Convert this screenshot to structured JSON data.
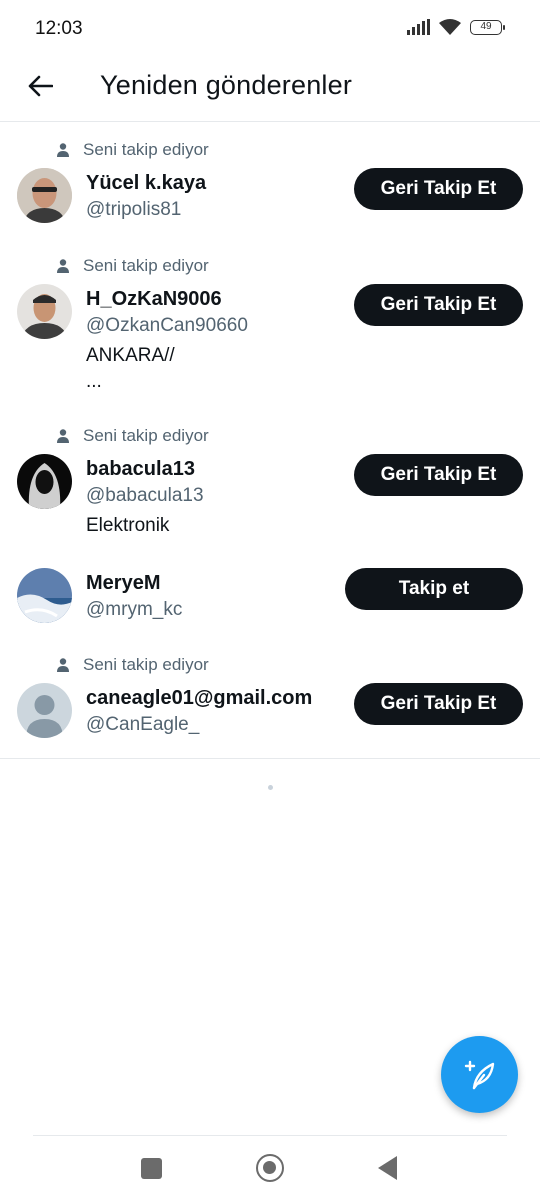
{
  "status_bar": {
    "time": "12:03",
    "battery": "49",
    "icons": [
      "signal-icon",
      "wifi-icon",
      "battery-icon"
    ]
  },
  "header": {
    "title": "Yeniden gönderenler",
    "back_icon": "arrow-left-icon"
  },
  "users": [
    {
      "follows_you": "Seni takip ediyor",
      "name": "Yücel k.kaya",
      "handle": "@tripolis81",
      "bio": [],
      "button": "Geri Takip Et"
    },
    {
      "follows_you": "Seni takip ediyor",
      "name": "H_OzKaN9006",
      "handle": "@OzkanCan90660",
      "bio": [
        "ANKARA//",
        "..."
      ],
      "button": "Geri Takip Et"
    },
    {
      "follows_you": "Seni takip ediyor",
      "name": "babacula13",
      "handle": "@babacula13",
      "bio": [
        "Elektronik"
      ],
      "button": "Geri Takip Et"
    },
    {
      "follows_you": "",
      "name": "MeryeM",
      "handle": "@mrym_kc",
      "bio": [],
      "button": "Takip et"
    },
    {
      "follows_you": "Seni takip ediyor",
      "name": "caneagle01@gmail.com",
      "handle": "@CanEagle_",
      "bio": [],
      "button": "Geri Takip Et"
    }
  ],
  "fab": {
    "icon": "compose-feather-icon"
  },
  "nav_bar": {
    "icons": [
      "recents-square-icon",
      "home-circle-icon",
      "back-triangle-icon"
    ]
  },
  "colors": {
    "accent": "#1d9bf0",
    "button": "#0f1419",
    "secondary_text": "#536471"
  }
}
